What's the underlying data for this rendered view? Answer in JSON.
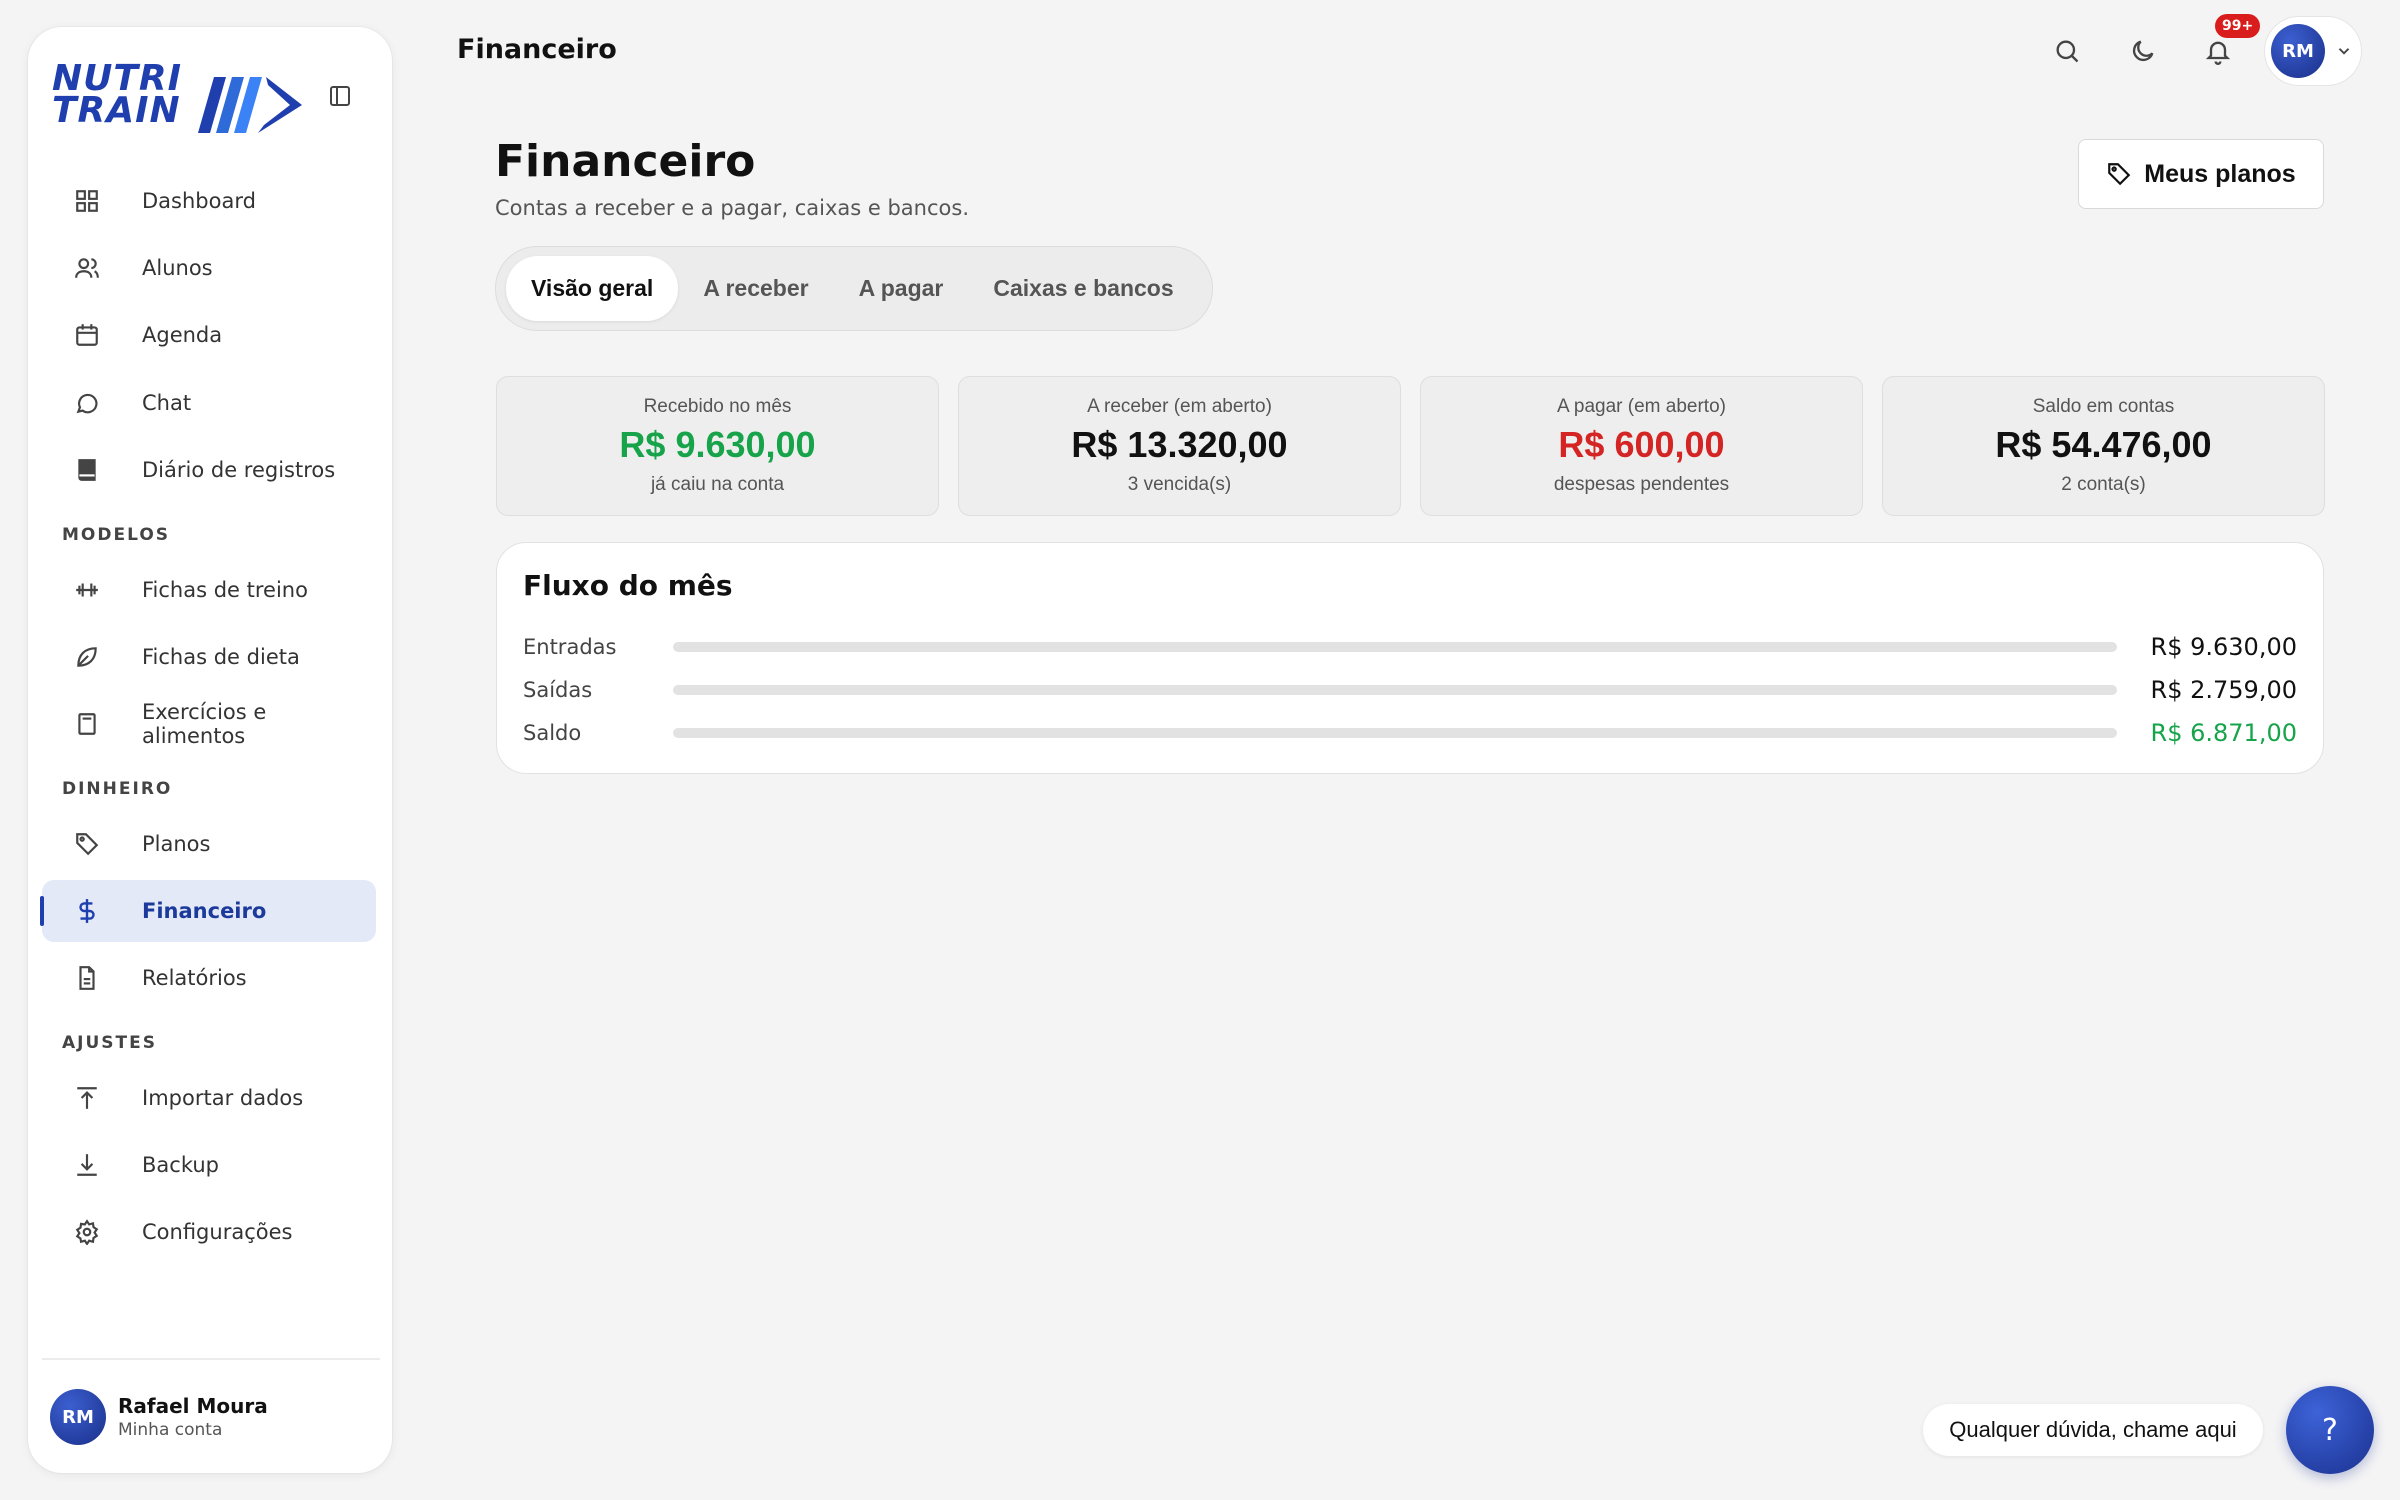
{
  "brand": {
    "line1": "NUTRI",
    "line2": "TRAIN",
    "color": "#1f3fae"
  },
  "sidebar": {
    "items": [
      {
        "label": "Dashboard",
        "icon": "grid-icon"
      },
      {
        "label": "Alunos",
        "icon": "users-icon"
      },
      {
        "label": "Agenda",
        "icon": "calendar-icon"
      },
      {
        "label": "Chat",
        "icon": "chat-bubble-icon"
      },
      {
        "label": "Diário de registros",
        "icon": "book-icon"
      },
      {
        "label": "Fichas de treino",
        "icon": "dumbbell-icon"
      },
      {
        "label": "Fichas de dieta",
        "icon": "leaf-icon"
      },
      {
        "label": "Exercícios e alimentos",
        "icon": "document-icon"
      },
      {
        "label": "Planos",
        "icon": "tag-icon"
      },
      {
        "label": "Financeiro",
        "icon": "dollar-icon",
        "active": true
      },
      {
        "label": "Relatórios",
        "icon": "file-text-icon"
      },
      {
        "label": "Importar dados",
        "icon": "upload-icon"
      },
      {
        "label": "Backup",
        "icon": "download-icon"
      },
      {
        "label": "Configurações",
        "icon": "gear-icon"
      }
    ],
    "sections": {
      "models": "MODELOS",
      "money": "DINHEIRO",
      "settings": "AJUSTES"
    },
    "user": {
      "initials": "RM",
      "name": "Rafael Moura",
      "subtitle": "Minha conta"
    }
  },
  "topbar": {
    "title": "Financeiro",
    "notification_count": "99+",
    "avatar_initials": "RM"
  },
  "page": {
    "title": "Financeiro",
    "subtitle": "Contas a receber e a pagar, caixas e bancos.",
    "plans_button": "Meus planos"
  },
  "tabs": [
    {
      "label": "Visão geral",
      "active": true
    },
    {
      "label": "A receber"
    },
    {
      "label": "A pagar"
    },
    {
      "label": "Caixas e bancos"
    }
  ],
  "kpis": [
    {
      "label": "Recebido no mês",
      "value": "R$ 9.630,00",
      "sub": "já caiu na conta",
      "tone": "green"
    },
    {
      "label": "A receber (em aberto)",
      "value": "R$ 13.320,00",
      "sub": "3 vencida(s)",
      "tone": "neutral"
    },
    {
      "label": "A pagar (em aberto)",
      "value": "R$ 600,00",
      "sub": "despesas pendentes",
      "tone": "red"
    },
    {
      "label": "Saldo em contas",
      "value": "R$ 54.476,00",
      "sub": "2 conta(s)",
      "tone": "neutral"
    }
  ],
  "flow": {
    "title": "Fluxo do mês",
    "rows": [
      {
        "label": "Entradas",
        "amount": "R$ 9.630,00",
        "fill": 100
      },
      {
        "label": "Saídas",
        "amount": "R$ 2.759,00",
        "fill": 100
      },
      {
        "label": "Saldo",
        "amount": "R$ 6.871,00",
        "fill": 100,
        "tone": "green"
      }
    ]
  },
  "help": {
    "bubble_text": "Qualquer dúvida, chame aqui",
    "button_label": "?"
  },
  "colors": {
    "accent": "#1f3fae",
    "positive": "#16a34a",
    "negative": "#d42424",
    "active_bg": "#e3e9f7"
  }
}
